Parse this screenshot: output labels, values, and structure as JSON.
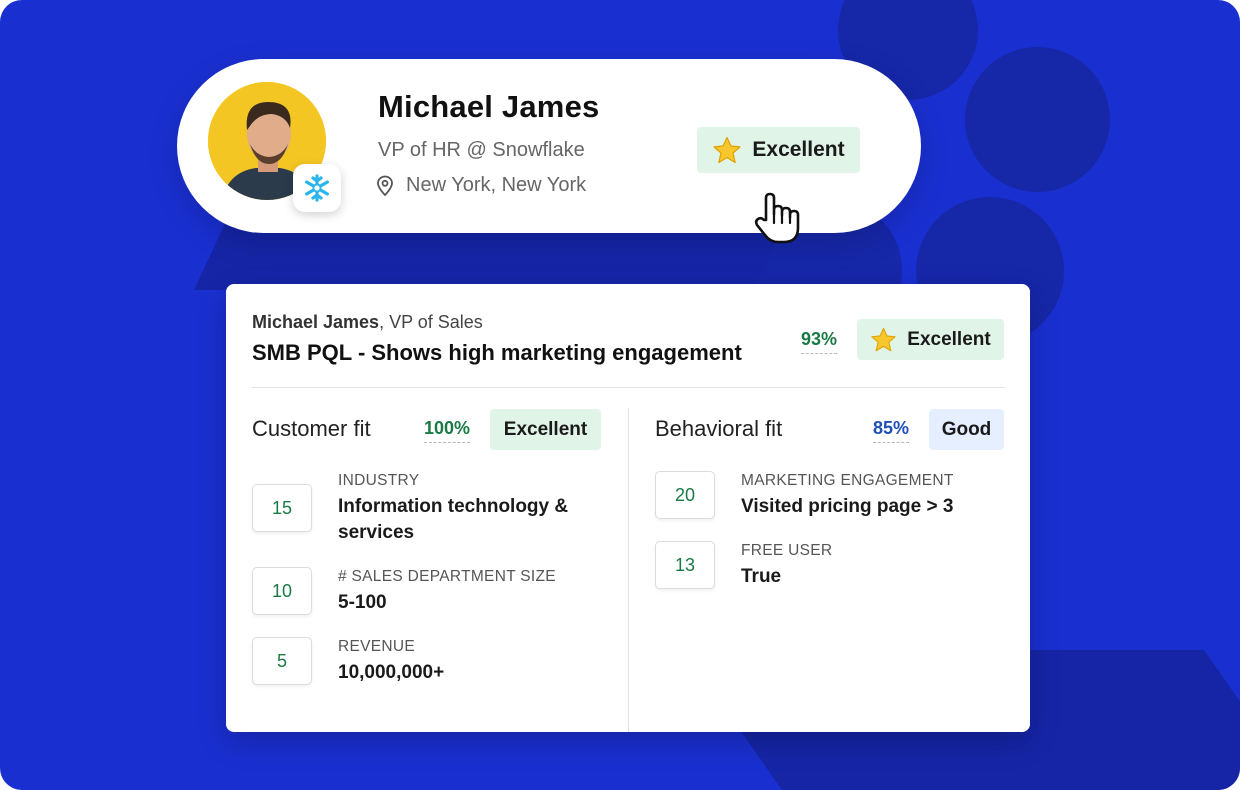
{
  "colors": {
    "background": "#1a2fd0",
    "excellent_badge": "#e1f4e8",
    "good_badge": "#e6efff",
    "score_green": "#1a7a45",
    "score_blue": "#1e4fb8"
  },
  "profile": {
    "name": "Michael James",
    "title": "VP of HR @ Snowflake",
    "location": "New York, New York",
    "rating_label": "Excellent",
    "rating_icon": "star-icon",
    "company_icon": "snowflake-icon",
    "location_icon": "map-pin-icon"
  },
  "lead": {
    "person_name": "Michael James",
    "person_role": ", VP of Sales",
    "headline": "SMB PQL - Shows high marketing engagement",
    "overall_score": "93%",
    "overall_label": "Excellent",
    "customer_fit": {
      "title": "Customer fit",
      "score": "100%",
      "label": "Excellent",
      "items": [
        {
          "points": "15",
          "label": "INDUSTRY",
          "value": "Information technology & services"
        },
        {
          "points": "10",
          "label": "# SALES DEPARTMENT SIZE",
          "value": "5-100"
        },
        {
          "points": "5",
          "label": "REVENUE",
          "value": "10,000,000+"
        }
      ]
    },
    "behavioral_fit": {
      "title": "Behavioral fit",
      "score": "85%",
      "label": "Good",
      "items": [
        {
          "points": "20",
          "label": "MARKETING ENGAGEMENT",
          "value": "Visited pricing page > 3"
        },
        {
          "points": "13",
          "label": "FREE USER",
          "value": "True"
        }
      ]
    }
  }
}
